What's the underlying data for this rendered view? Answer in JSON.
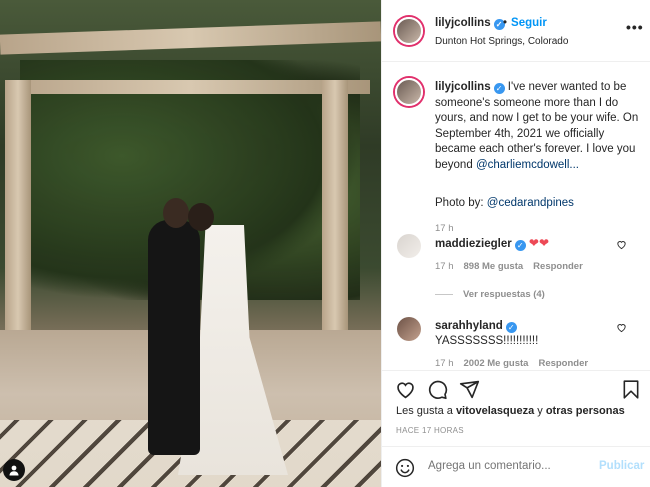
{
  "post": {
    "photo_alt": "",
    "header": {
      "username": "lilyjcollins",
      "separator": "•",
      "follow_label": "Seguir",
      "location": "Dunton Hot Springs, Colorado"
    },
    "caption": {
      "username": "lilyjcollins",
      "text": " I've never wanted to be someone's someone more than I do yours, and now I get to be your wife. On September 4th, 2021 we officially became each other's forever. I love you beyond ",
      "mention": "@charliemcdowell...",
      "photo_by_label": "Photo by: ",
      "photo_by_mention": "@cedarandpines",
      "time": "17 h"
    },
    "comments": [
      {
        "username": "maddieziegler",
        "text": "❤❤",
        "time": "17 h",
        "likes": "898 Me gusta",
        "reply": "Responder"
      },
      {
        "username": "sarahhyland",
        "text": "YASSSSSSS!!!!!!!!!!!",
        "time": "17 h",
        "likes": "2002 Me gusta",
        "reply": "Responder"
      }
    ],
    "view_replies": "Ver respuestas (4)",
    "likes_prefix": "Les gusta a ",
    "likes_user": "vitovelasqueza",
    "likes_mid": " y ",
    "likes_others": "otras personas",
    "posted_ago": "HACE 17 HORAS",
    "comment_placeholder": "Agrega un comentario...",
    "publish_label": "Publicar"
  },
  "icons": [
    "heart-icon",
    "comment-icon",
    "share-icon",
    "bookmark-icon",
    "more-icon",
    "emoji-icon",
    "user-tag-icon",
    "verified-icon"
  ],
  "colors": {
    "link": "#0095f6",
    "mention": "#00376b",
    "heart": "#ed4956",
    "muted": "#8e8e8e",
    "publish_disabled": "#b2dffc"
  }
}
